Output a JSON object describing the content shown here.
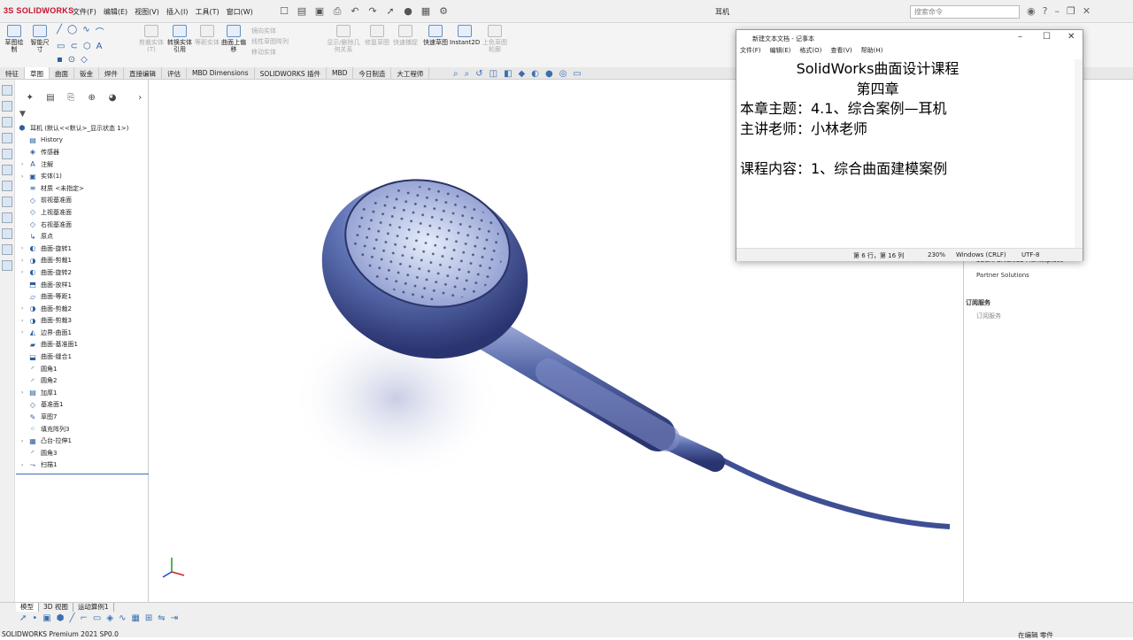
{
  "app": {
    "logo_text": "3S SOLIDWORKS",
    "menus": [
      "文件(F)",
      "编辑(E)",
      "视图(V)",
      "插入(I)",
      "工具(T)",
      "窗口(W)"
    ],
    "window_title": "耳机",
    "search_placeholder": "搜索命令"
  },
  "command_manager": {
    "buttons": [
      {
        "label": "草图绘制",
        "enabled": true
      },
      {
        "label": "智能尺寸",
        "enabled": true
      },
      {
        "label": "剪裁实体(T)",
        "enabled": false
      },
      {
        "label": "转换实体引用",
        "enabled": true
      },
      {
        "label": "等距实体",
        "enabled": false
      },
      {
        "label": "曲面上偏移",
        "enabled": true
      },
      {
        "label": "镜向实体",
        "enabled": false
      },
      {
        "label": "线性草图阵列",
        "enabled": false
      },
      {
        "label": "移动实体",
        "enabled": false
      },
      {
        "label": "显示/删除几何关系",
        "enabled": false
      },
      {
        "label": "修复草图",
        "enabled": false
      },
      {
        "label": "快速捕捉",
        "enabled": false
      },
      {
        "label": "快速草图",
        "enabled": true
      },
      {
        "label": "Instant2D",
        "enabled": true
      },
      {
        "label": "上色草图轮廓",
        "enabled": false
      }
    ],
    "tabs": [
      "特征",
      "草图",
      "曲面",
      "钣金",
      "焊件",
      "直接编辑",
      "评估",
      "MBD Dimensions",
      "SOLIDWORKS 插件",
      "MBD",
      "今日制造",
      "大工程师"
    ],
    "active_tab": "草图"
  },
  "feature_tree": {
    "root": "耳机 (默认<<默认>_显示状态 1>)",
    "items": [
      {
        "label": "History",
        "icon": "folder-icon",
        "expand": false
      },
      {
        "label": "传感器",
        "icon": "sensor-icon",
        "expand": false
      },
      {
        "label": "注解",
        "icon": "annotation-icon",
        "expand": true
      },
      {
        "label": "实体(1)",
        "icon": "solid-body-icon",
        "expand": true
      },
      {
        "label": "材质 <未指定>",
        "icon": "material-icon",
        "expand": false
      },
      {
        "label": "前视基准面",
        "icon": "plane-icon",
        "expand": false
      },
      {
        "label": "上视基准面",
        "icon": "plane-icon",
        "expand": false
      },
      {
        "label": "右视基准面",
        "icon": "plane-icon",
        "expand": false
      },
      {
        "label": "原点",
        "icon": "origin-icon",
        "expand": false
      },
      {
        "label": "曲面-旋转1",
        "icon": "surface-revolve-icon",
        "expand": true
      },
      {
        "label": "曲面-剪裁1",
        "icon": "surface-trim-icon",
        "expand": true
      },
      {
        "label": "曲面-旋转2",
        "icon": "surface-revolve-icon",
        "expand": true
      },
      {
        "label": "曲面-放样1",
        "icon": "surface-loft-icon",
        "expand": false
      },
      {
        "label": "曲面-等距1",
        "icon": "surface-offset-icon",
        "expand": false
      },
      {
        "label": "曲面-剪裁2",
        "icon": "surface-trim-icon",
        "expand": true
      },
      {
        "label": "曲面-剪裁3",
        "icon": "surface-trim-icon",
        "expand": true
      },
      {
        "label": "边界-曲面1",
        "icon": "boundary-surface-icon",
        "expand": true
      },
      {
        "label": "曲面-基准面1",
        "icon": "planar-surface-icon",
        "expand": false
      },
      {
        "label": "曲面-缝合1",
        "icon": "knit-surface-icon",
        "expand": false
      },
      {
        "label": "圆角1",
        "icon": "fillet-icon",
        "expand": false
      },
      {
        "label": "圆角2",
        "icon": "fillet-icon",
        "expand": false
      },
      {
        "label": "加厚1",
        "icon": "thicken-icon",
        "expand": true
      },
      {
        "label": "基准面1",
        "icon": "plane-icon",
        "expand": false
      },
      {
        "label": "草图7",
        "icon": "sketch-icon",
        "expand": false
      },
      {
        "label": "填充阵列3",
        "icon": "fill-pattern-icon",
        "expand": false
      },
      {
        "label": "凸台-拉伸1",
        "icon": "extrude-icon",
        "expand": true
      },
      {
        "label": "圆角3",
        "icon": "fillet-icon",
        "expand": false
      },
      {
        "label": "扫描1",
        "icon": "sweep-icon",
        "expand": true
      }
    ]
  },
  "right_panel": {
    "items": [
      "3DEXPERIENCE Marketplace",
      "Partner Solutions"
    ],
    "section": "订阅服务",
    "section_item": "订阅服务"
  },
  "notepad": {
    "title": "新建文本文档 - 记事本",
    "menus": [
      "文件(F)",
      "编辑(E)",
      "格式(O)",
      "查看(V)",
      "帮助(H)"
    ],
    "lines": [
      "SolidWorks曲面设计课程",
      "第四章",
      "本章主题：4.1、综合案例—耳机",
      "主讲老师：小林老师",
      "",
      "课程内容：1、综合曲面建模案例"
    ],
    "status": {
      "position": "第 6 行，第 16 列",
      "zoom": "230%",
      "line_ending": "Windows (CRLF)",
      "encoding": "UTF-8"
    }
  },
  "bottom": {
    "tabs": [
      "模型",
      "3D 视图",
      "运动算例1"
    ],
    "status_left": "SOLIDWORKS Premium 2021 SP0.0",
    "status_right": "在编辑 零件"
  },
  "colors": {
    "accent": "#3a6fb0",
    "model": "#4a5f9e",
    "brand": "#c8102e"
  }
}
